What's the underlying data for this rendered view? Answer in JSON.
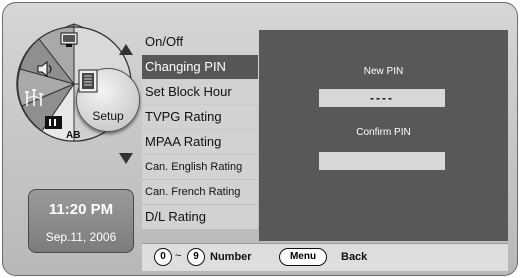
{
  "wheel": {
    "setup_label": "Setup",
    "icons": [
      "display-icon",
      "speaker-icon",
      "antenna-icon",
      "lock-settings-icon",
      "ab-icon"
    ],
    "ab_label": "AB"
  },
  "clock": {
    "time": "11:20 PM",
    "date": "Sep.11, 2006"
  },
  "menu": {
    "items": [
      {
        "label": "On/Off"
      },
      {
        "label": "Changing PIN"
      },
      {
        "label": "Set Block Hour"
      },
      {
        "label": "TVPG Rating"
      },
      {
        "label": "MPAA Rating"
      },
      {
        "label": "Can. English Rating"
      },
      {
        "label": "Can. French Rating"
      },
      {
        "label": "D/L Rating"
      }
    ],
    "selected_index": 1
  },
  "panel": {
    "new_pin_label": "New PIN",
    "new_pin_value": "----",
    "confirm_pin_label": "Confirm PIN",
    "confirm_pin_value": ""
  },
  "bottom_bar": {
    "from_key": "0",
    "tilde": "~",
    "to_key": "9",
    "number_label": "Number",
    "menu_key": "Menu",
    "back_label": "Back"
  }
}
